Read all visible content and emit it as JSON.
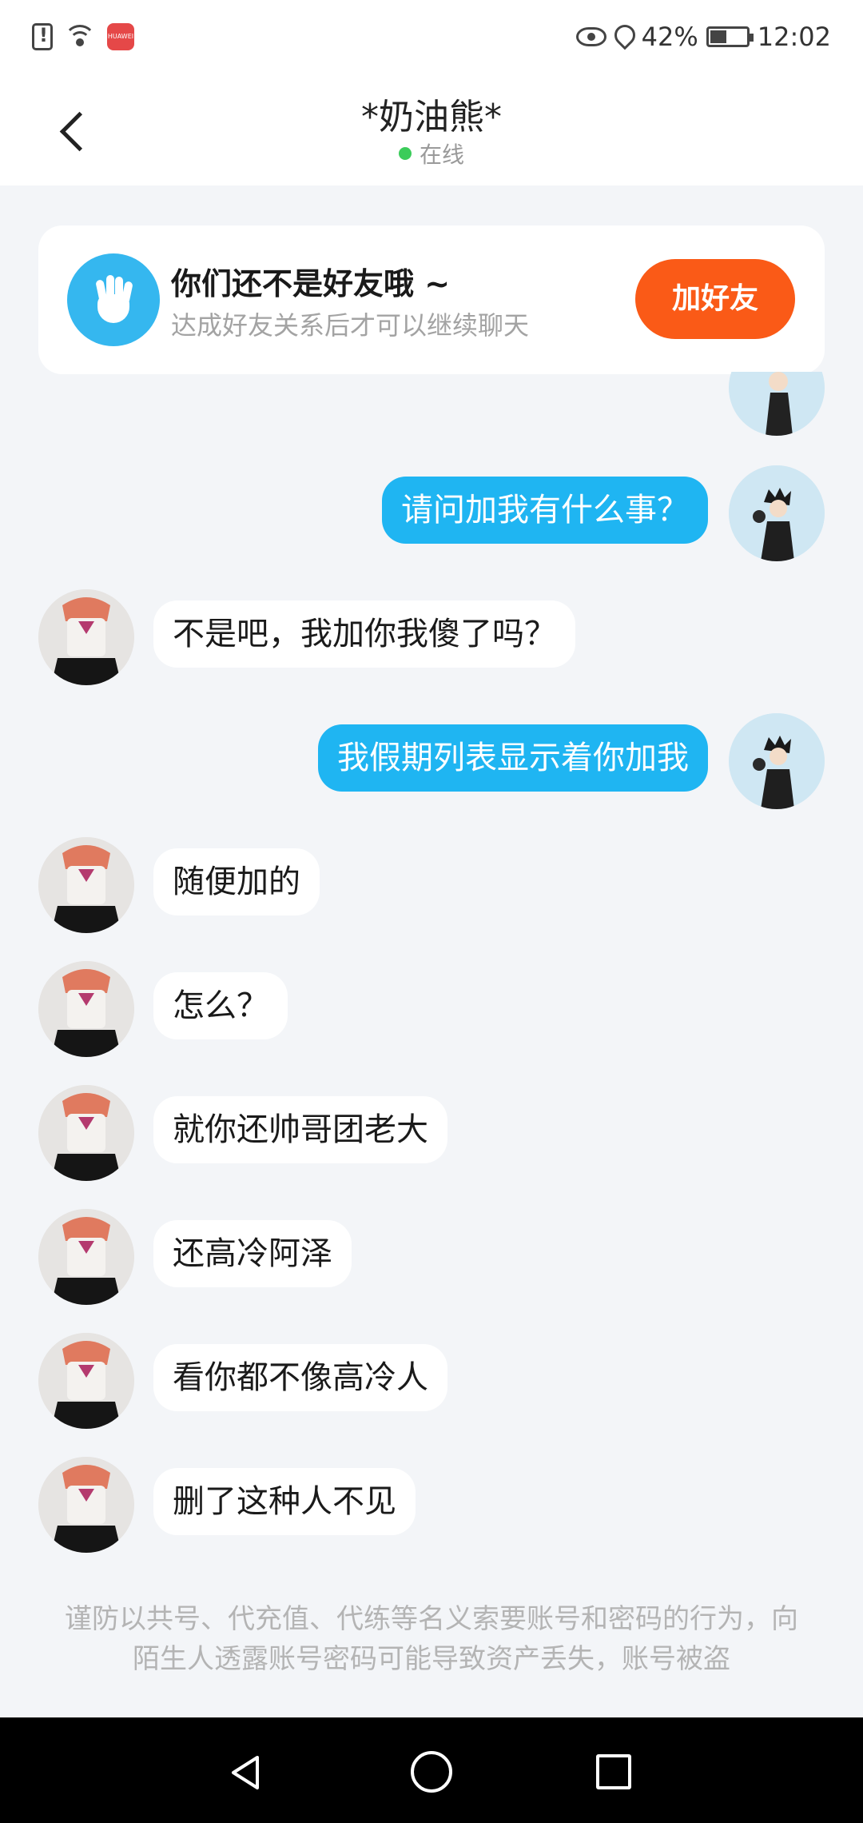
{
  "status_bar": {
    "battery": "42%",
    "time": "12:02",
    "brand_badge": "HUAWEI"
  },
  "header": {
    "title": "*奶油熊*",
    "status": "在线"
  },
  "friend_banner": {
    "title": "你们还不是好友哦 ~",
    "subtitle": "达成好友关系后才可以继续聊天",
    "add_button": "加好友"
  },
  "messages": [
    {
      "from": "self",
      "text": "请问加我有什么事？"
    },
    {
      "from": "other",
      "text": "不是吧，我加你我傻了吗？"
    },
    {
      "from": "self",
      "text": "我假期列表显示着你加我"
    },
    {
      "from": "other",
      "text": "随便加的"
    },
    {
      "from": "other",
      "text": "怎么？"
    },
    {
      "from": "other",
      "text": "就你还帅哥团老大"
    },
    {
      "from": "other",
      "text": "还高冷阿泽"
    },
    {
      "from": "other",
      "text": "看你都不像高冷人"
    },
    {
      "from": "other",
      "text": "删了这种人不见"
    }
  ],
  "safety_warning": "谨防以共号、代充值、代练等名义索要账号和密码的行为，向陌生人透露账号密码可能导致资产丢失，账号被盗",
  "colors": {
    "self_bubble": "#1fb5f2",
    "add_button": "#fa5a17",
    "online_dot": "#3bcc5a",
    "background": "#f3f5f8"
  }
}
